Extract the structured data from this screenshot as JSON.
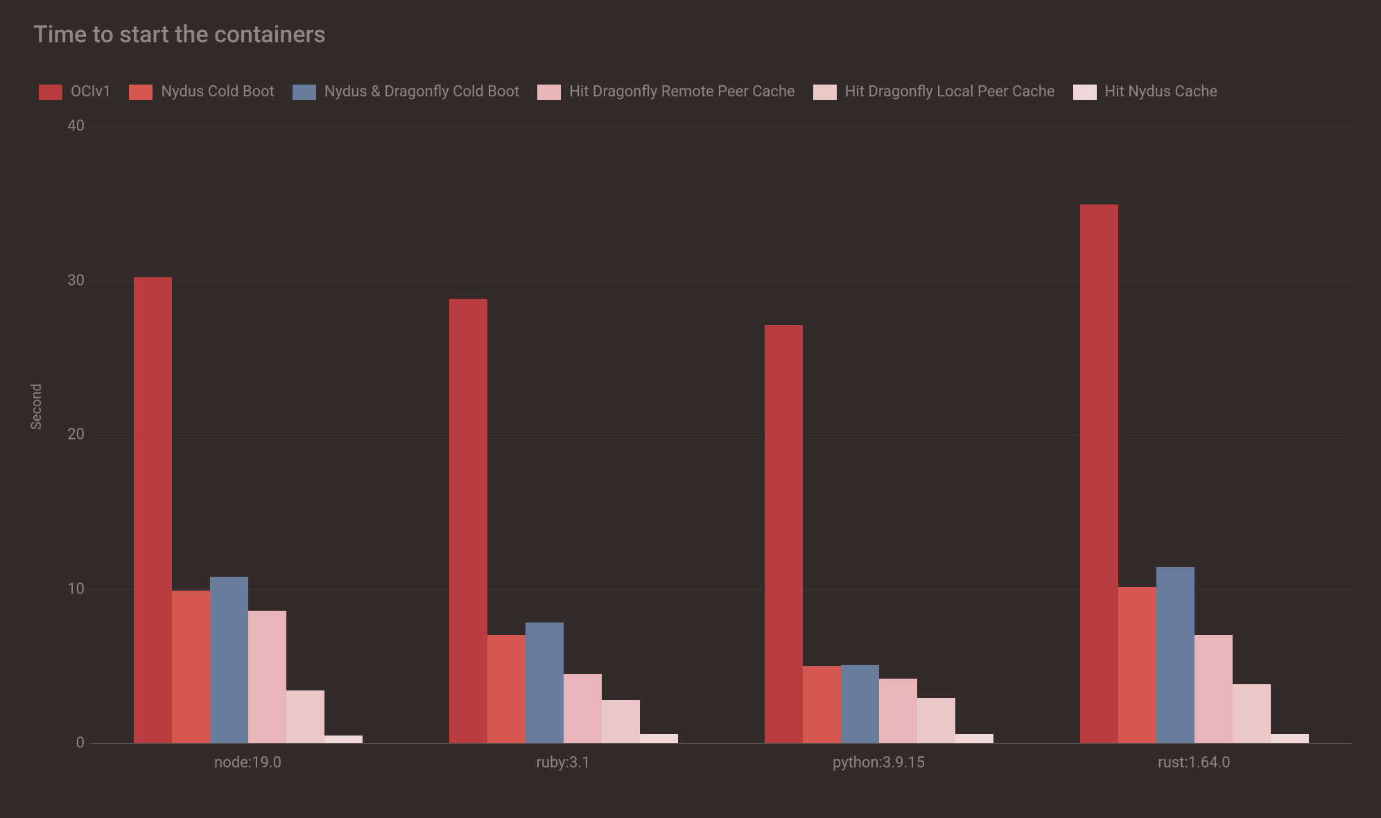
{
  "chart_data": {
    "type": "bar",
    "title": "Time to start the containers",
    "ylabel": "Second",
    "xlabel": "",
    "ylim": [
      0,
      40
    ],
    "yticks": [
      0,
      10,
      20,
      30,
      40
    ],
    "categories": [
      "node:19.0",
      "ruby:3.1",
      "python:3.9.15",
      "rust:1.64.0"
    ],
    "series": [
      {
        "name": "OCIv1",
        "color": "#b93d3e",
        "values": [
          30.2,
          28.8,
          27.1,
          34.9
        ]
      },
      {
        "name": "Nydus Cold Boot",
        "color": "#d55851",
        "values": [
          9.9,
          7.0,
          5.0,
          10.1
        ]
      },
      {
        "name": "Nydus & Dragonfly Cold Boot",
        "color": "#6a7c9e",
        "values": [
          10.8,
          7.8,
          5.1,
          11.4
        ]
      },
      {
        "name": "Hit Dragonfly Remote Peer Cache",
        "color": "#e8b6b8",
        "values": [
          8.6,
          4.5,
          4.2,
          7.0
        ]
      },
      {
        "name": "Hit Dragonfly Local Peer Cache",
        "color": "#ecc7c8",
        "values": [
          3.4,
          2.8,
          2.9,
          3.8
        ]
      },
      {
        "name": "Hit Nydus Cache",
        "color": "#f0d8d9",
        "values": [
          0.5,
          0.6,
          0.6,
          0.6
        ]
      }
    ]
  }
}
